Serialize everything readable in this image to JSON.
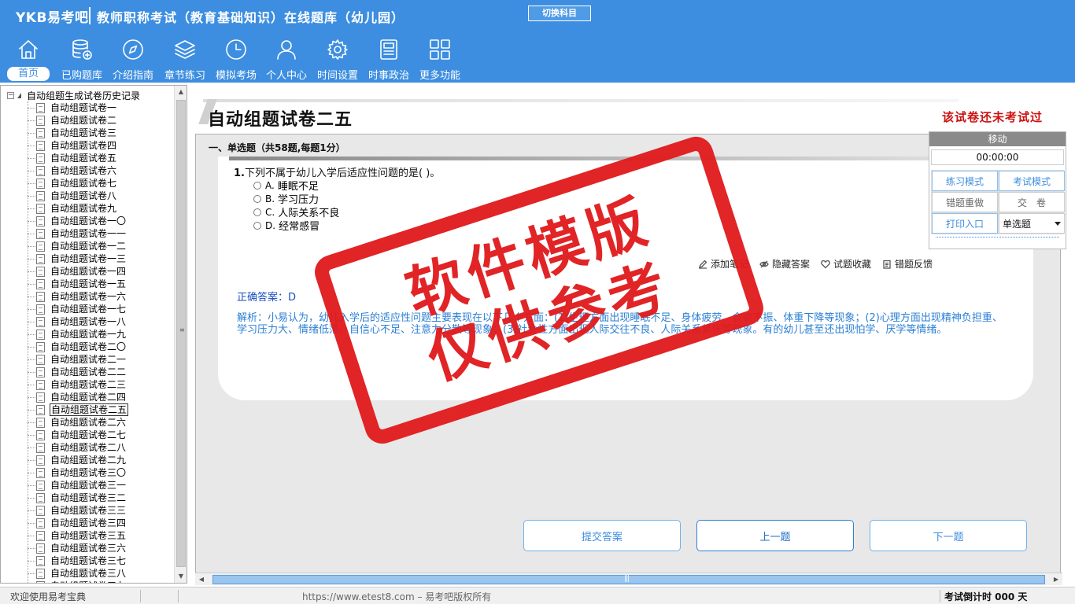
{
  "header": {
    "brand": "YKB易考吧",
    "title": "教师职称考试（教育基础知识）在线题库（幼儿园）",
    "switch_subject": "切换科目",
    "nav": [
      {
        "label": "首页",
        "icon": "home-icon"
      },
      {
        "label": "已购题库",
        "icon": "database-icon"
      },
      {
        "label": "介绍指南",
        "icon": "compass-icon"
      },
      {
        "label": "章节练习",
        "icon": "layers-icon"
      },
      {
        "label": "模拟考场",
        "icon": "clock-icon"
      },
      {
        "label": "个人中心",
        "icon": "user-icon"
      },
      {
        "label": "时间设置",
        "icon": "gear-icon"
      },
      {
        "label": "时事政治",
        "icon": "news-icon"
      },
      {
        "label": "更多功能",
        "icon": "grid-icon"
      }
    ]
  },
  "tree": {
    "root": "自动组题生成试卷历史记录",
    "items": [
      "自动组题试卷一",
      "自动组题试卷二",
      "自动组题试卷三",
      "自动组题试卷四",
      "自动组题试卷五",
      "自动组题试卷六",
      "自动组题试卷七",
      "自动组题试卷八",
      "自动组题试卷九",
      "自动组题试卷一〇",
      "自动组题试卷一一",
      "自动组题试卷一二",
      "自动组题试卷一三",
      "自动组题试卷一四",
      "自动组题试卷一五",
      "自动组题试卷一六",
      "自动组题试卷一七",
      "自动组题试卷一八",
      "自动组题试卷一九",
      "自动组题试卷二〇",
      "自动组题试卷二一",
      "自动组题试卷二二",
      "自动组题试卷二三",
      "自动组题试卷二四",
      "自动组题试卷二五",
      "自动组题试卷二六",
      "自动组题试卷二七",
      "自动组题试卷二八",
      "自动组题试卷二九",
      "自动组题试卷三〇",
      "自动组题试卷三一",
      "自动组题试卷三二",
      "自动组题试卷三三",
      "自动组题试卷三四",
      "自动组题试卷三五",
      "自动组题试卷三六",
      "自动组题试卷三七",
      "自动组题试卷三八",
      "自动组题试卷三九"
    ],
    "selected_index": 24
  },
  "main": {
    "paper_title": "自动组题试卷二五",
    "status": "该试卷还未考试过",
    "section": "一、单选题（共58题,每题1分）",
    "question": {
      "number": "1.",
      "stem": "下列不属于幼儿入学后适应性问题的是( )。",
      "options": [
        {
          "letter": "A.",
          "text": "睡眠不足"
        },
        {
          "letter": "B.",
          "text": "学习压力"
        },
        {
          "letter": "C.",
          "text": "人际关系不良"
        },
        {
          "letter": "D.",
          "text": "经常感冒"
        }
      ]
    },
    "actions": [
      {
        "label": "添加笔记",
        "icon": "pencil-icon"
      },
      {
        "label": "隐藏答案",
        "icon": "eye-icon"
      },
      {
        "label": "试题收藏",
        "icon": "heart-icon"
      },
      {
        "label": "错题反馈",
        "icon": "clipboard-icon"
      }
    ],
    "answer": "正确答案：D",
    "analysis": "解析：小易认为，幼儿入学后的适应性问题主要表现在以下几个方面：(1)生理方面出现睡眠不足、身体疲劳、食欲不振、体重下降等现象；(2)心理方面出现精神负担重、学习压力大、情绪低落、自信心不足、注意力分散等现象；(3)社会性方面出现人际交往不良、人际关系紧张等现象。有的幼儿甚至还出现怕学、厌学等情绪。",
    "buttons": {
      "submit": "提交答案",
      "prev": "上一题",
      "next": "下一题"
    }
  },
  "float_panel": {
    "title": "移动",
    "timer": "00:00:00",
    "practice_mode": "练习模式",
    "exam_mode": "考试模式",
    "redo_wrong": "错题重做",
    "hand_in": "交　卷",
    "print": "打印入口",
    "question_type": "单选题"
  },
  "watermark": {
    "line1": "软件模版",
    "line2": "仅供参考"
  },
  "statusbar": {
    "welcome": "欢迎使用易考宝典",
    "copyright": "https://www.etest8.com – 易考吧版权所有",
    "countdown": "考试倒计时 000 天"
  },
  "colors": {
    "header_bg": "#3d8ee0",
    "status_red": "#cc1111",
    "answer_blue": "#1b4fbf",
    "analysis_blue": "#2a7fd4",
    "stamp_red": "#e0191b"
  }
}
